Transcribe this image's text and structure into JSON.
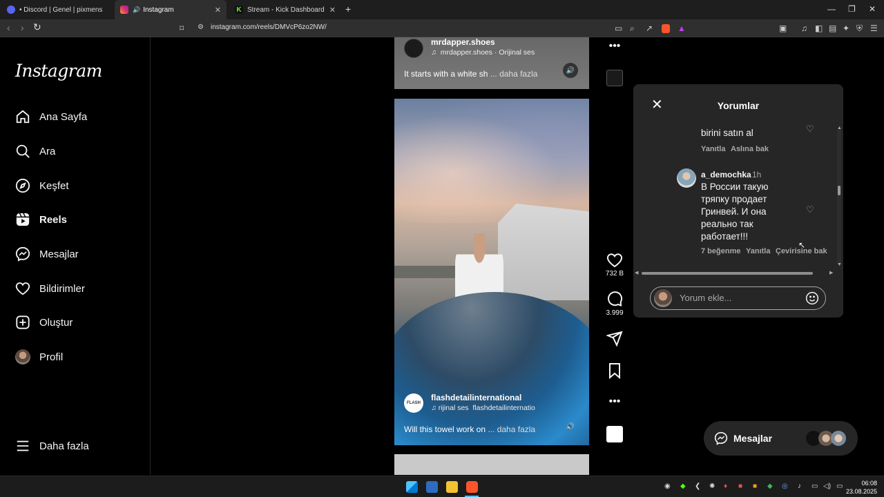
{
  "browser": {
    "tabs": [
      {
        "title": "• Discord | Genel | pixmens",
        "icon": "discord-icon",
        "color": "#5865f2"
      },
      {
        "title": "Instagram",
        "icon": "instagram-icon",
        "color": "#e1306c",
        "active": true
      },
      {
        "title": "Stream - Kick Dashboard",
        "icon": "kick-icon",
        "color": "#53fc18"
      }
    ],
    "new_tab": "+",
    "url": "instagram.com/reels/DMVcP6zo2NW/",
    "window_controls": [
      "—",
      "❐",
      "✕"
    ]
  },
  "sidebar": {
    "logo": "Instagram",
    "items": [
      {
        "label": "Ana Sayfa",
        "icon": "home-icon"
      },
      {
        "label": "Ara",
        "icon": "search-icon"
      },
      {
        "label": "Keşfet",
        "icon": "compass-icon"
      },
      {
        "label": "Reels",
        "icon": "reels-icon",
        "active": true
      },
      {
        "label": "Mesajlar",
        "icon": "messenger-icon"
      },
      {
        "label": "Bildirimler",
        "icon": "heart-icon"
      },
      {
        "label": "Oluştur",
        "icon": "plus-square-icon"
      },
      {
        "label": "Profil",
        "icon": "avatar"
      }
    ],
    "more": "Daha fazla"
  },
  "reel_top": {
    "username": "mrdapper.shoes",
    "audio": "mrdapper.shoes · Orijinal ses",
    "caption": "It starts with a white sh",
    "more": "... daha fazla"
  },
  "reel_main": {
    "username": "flashdetailinternational",
    "audio_a": "rijinal ses",
    "audio_b": "flashdetailinternatio",
    "caption": "Will this towel work on",
    "more": "... daha fazla",
    "avatar_text": "FLASH"
  },
  "actions": {
    "likes": "732 B",
    "comments": "3.999"
  },
  "comments": {
    "title": "Yorumlar",
    "list": [
      {
        "text": "birini satın al",
        "reply": "Yanıtla",
        "see_original": "Aslına bak"
      },
      {
        "user": "a_demochka",
        "time": "1h",
        "lines": [
          "В России такую",
          "тряпку продает",
          "Гринвей. И она",
          "реально так",
          "работает!!!"
        ],
        "likes": "7 beğenme",
        "reply": "Yanıtla",
        "translate": "Çevirisine bak"
      }
    ],
    "input_placeholder": "Yorum ekle..."
  },
  "messages_pill": {
    "label": "Mesajlar"
  },
  "taskbar": {
    "time": "06:08",
    "date": "23.08.2025"
  }
}
